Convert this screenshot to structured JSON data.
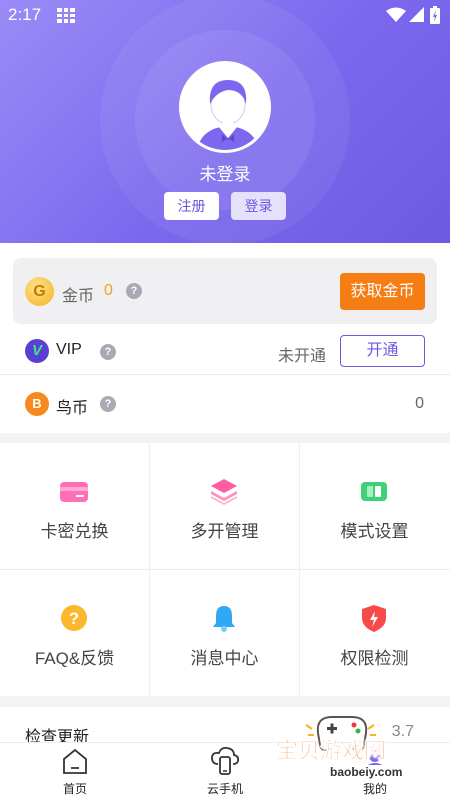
{
  "status_bar": {
    "time": "2:17"
  },
  "profile": {
    "login_state": "未登录",
    "register_label": "注册",
    "login_label": "登录"
  },
  "coins": {
    "label": "金币",
    "value": "0",
    "get_button": "获取金币"
  },
  "vip": {
    "label": "VIP",
    "status": "未开通",
    "open_button": "开通"
  },
  "bird_coin": {
    "label": "鸟币",
    "value": "0"
  },
  "features": [
    {
      "label": "卡密兑换",
      "icon": "card-icon"
    },
    {
      "label": "多开管理",
      "icon": "layers-icon"
    },
    {
      "label": "模式设置",
      "icon": "mode-icon"
    },
    {
      "label": "FAQ&反馈",
      "icon": "question-icon"
    },
    {
      "label": "消息中心",
      "icon": "bell-icon"
    },
    {
      "label": "权限检测",
      "icon": "shield-icon"
    }
  ],
  "update": {
    "label": "检查更新",
    "version": "3.7"
  },
  "tabs": [
    {
      "label": "首页",
      "icon": "home-icon"
    },
    {
      "label": "云手机",
      "icon": "cloud-phone-icon"
    },
    {
      "label": "我的",
      "icon": "profile-icon"
    }
  ],
  "watermark": {
    "text": "宝贝游戏网",
    "url": "baobeiy.com"
  },
  "colors": {
    "accent": "#7b68ee",
    "orange": "#f57d14",
    "gold": "#f0a020"
  }
}
